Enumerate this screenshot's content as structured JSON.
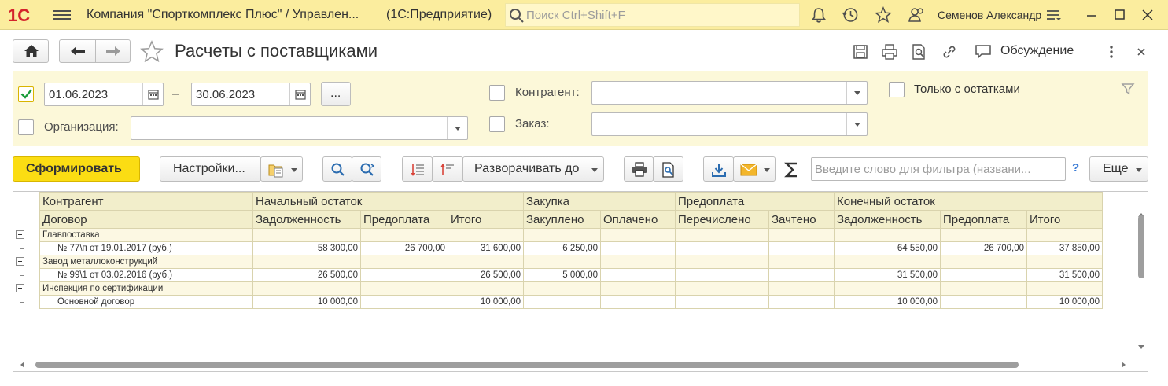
{
  "titlebar": {
    "logo_text": "1С",
    "title": "Компания \"Спорткомплекс Плюс\" / Управлен...",
    "subtitle": "(1С:Предприятие)",
    "search_placeholder": "Поиск Ctrl+Shift+F",
    "user": "Семенов Александр"
  },
  "form": {
    "title": "Расчеты с поставщиками",
    "discuss_label": "Обсуждение"
  },
  "filters": {
    "date_from": "01.06.2023",
    "date_dash": "–",
    "date_to": "30.06.2023",
    "period_btn": "...",
    "org_label": "Организация:",
    "org_value": "",
    "counterparty_label": "Контрагент:",
    "counterparty_value": "",
    "order_label": "Заказ:",
    "order_value": "",
    "only_balance_label": "Только с остатками"
  },
  "toolbar": {
    "generate": "Сформировать",
    "settings": "Настройки...",
    "expand_to": "Разворачивать до",
    "filter_placeholder": "Введите слово для фильтра (названи...",
    "help": "?",
    "more": "Еще"
  },
  "report": {
    "header1": [
      "Контрагент",
      "Начальный остаток",
      "Закупка",
      "Предоплата",
      "Конечный остаток"
    ],
    "header2": [
      "Договор",
      "Задолженность",
      "Предоплата",
      "Итого",
      "Закуплено",
      "Оплачено",
      "Перечислено",
      "Зачтено",
      "Задолженность",
      "Предоплата",
      "Итого"
    ],
    "rows": [
      {
        "type": "group",
        "cells": [
          "Главпоставка",
          "",
          "",
          "",
          "",
          "",
          "",
          "",
          "",
          "",
          ""
        ]
      },
      {
        "type": "detail",
        "cells": [
          "№ 77\\п от 19.01.2017 (руб.)",
          "58 300,00",
          "26 700,00",
          "31 600,00",
          "6 250,00",
          "",
          "",
          "",
          "64 550,00",
          "26 700,00",
          "37 850,00"
        ]
      },
      {
        "type": "group",
        "cells": [
          "Завод металлоконструкций",
          "",
          "",
          "",
          "",
          "",
          "",
          "",
          "",
          "",
          ""
        ]
      },
      {
        "type": "detail",
        "cells": [
          "№ 99\\1 от 03.02.2016 (руб.)",
          "26 500,00",
          "",
          "26 500,00",
          "5 000,00",
          "",
          "",
          "",
          "31 500,00",
          "",
          "31 500,00"
        ]
      },
      {
        "type": "group",
        "cells": [
          "Инспекция по сертификации",
          "",
          "",
          "",
          "",
          "",
          "",
          "",
          "",
          "",
          ""
        ]
      },
      {
        "type": "detail",
        "cells": [
          "Основной договор",
          "10 000,00",
          "",
          "10 000,00",
          "",
          "",
          "",
          "",
          "10 000,00",
          "",
          "10 000,00"
        ]
      }
    ]
  },
  "colors": {
    "titlebar_bg": "#fbed9e",
    "filter_bg": "#fcf8d9",
    "generate_bg": "#fbdd13",
    "header_bg": "#f2eecb",
    "logo_red": "#d4232b"
  }
}
